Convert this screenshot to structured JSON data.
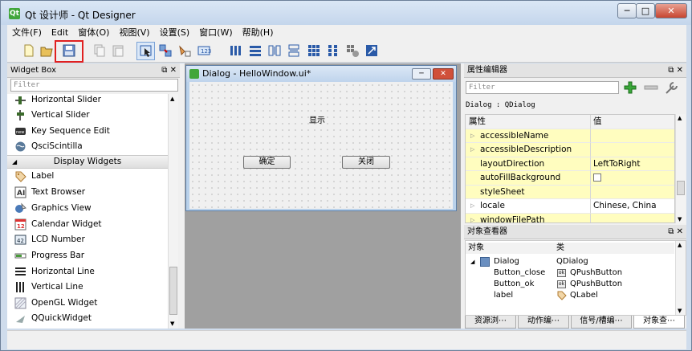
{
  "window": {
    "title": "Qt 设计师 - Qt Designer",
    "app_icon": "Qt"
  },
  "menu": [
    "文件(F)",
    "Edit",
    "窗体(O)",
    "视图(V)",
    "设置(S)",
    "窗口(W)",
    "帮助(H)"
  ],
  "toolbar_icons": [
    "new-file-icon",
    "open-file-icon",
    "save-icon",
    "copy-icon",
    "paste-icon",
    "edit-widgets-icon",
    "edit-signals-icon",
    "edit-buddies-icon",
    "edit-tab-order-icon",
    "layout-horizontal-icon",
    "layout-vertical-icon",
    "layout-h-splitter-icon",
    "layout-v-splitter-icon",
    "layout-grid-icon",
    "layout-form-icon",
    "break-layout-icon",
    "adjust-size-icon"
  ],
  "widget_box": {
    "title": "Widget Box",
    "controls": "⧉ ✕",
    "filter_placeholder": "Filter",
    "items_top": [
      {
        "label": "Horizontal Slider",
        "icon": "horizontal-slider-icon"
      },
      {
        "label": "Vertical Slider",
        "icon": "vertical-slider-icon"
      },
      {
        "label": "Key Sequence Edit",
        "icon": "key-sequence-edit-icon"
      },
      {
        "label": "QsciScintilla",
        "icon": "qsciscintilla-icon"
      }
    ],
    "category": "Display Widgets",
    "items_display": [
      {
        "label": "Label",
        "icon": "label-icon"
      },
      {
        "label": "Text Browser",
        "icon": "text-browser-icon"
      },
      {
        "label": "Graphics View",
        "icon": "graphics-view-icon"
      },
      {
        "label": "Calendar Widget",
        "icon": "calendar-widget-icon",
        "glyph": "12"
      },
      {
        "label": "LCD Number",
        "icon": "lcd-number-icon",
        "glyph": "42"
      },
      {
        "label": "Progress Bar",
        "icon": "progress-bar-icon"
      },
      {
        "label": "Horizontal Line",
        "icon": "horizontal-line-icon"
      },
      {
        "label": "Vertical Line",
        "icon": "vertical-line-icon"
      },
      {
        "label": "OpenGL Widget",
        "icon": "opengl-widget-icon"
      },
      {
        "label": "QQuickWidget",
        "icon": "qquickwidget-icon"
      }
    ]
  },
  "dialog": {
    "title": "Dialog - HelloWindow.ui*",
    "label_text": "显示",
    "ok_button": "确定",
    "close_button": "关闭"
  },
  "property_editor": {
    "title": "属性编辑器",
    "controls": "⧉ ✕",
    "filter_placeholder": "Filter",
    "object_caption": "Dialog : QDialog",
    "col_property": "属性",
    "col_value": "值",
    "rows": [
      {
        "name": "accessibleName",
        "value": "",
        "expandable": true
      },
      {
        "name": "accessibleDescription",
        "value": "",
        "expandable": true
      },
      {
        "name": "layoutDirection",
        "value": "LeftToRight",
        "expandable": false
      },
      {
        "name": "autoFillBackground",
        "value": "",
        "checkbox": true,
        "checked": false,
        "expandable": false
      },
      {
        "name": "styleSheet",
        "value": "",
        "expandable": false
      },
      {
        "name": "locale",
        "value": "Chinese, China",
        "expandable": true
      },
      {
        "name": "windowFilePath",
        "value": "",
        "expandable": true
      }
    ]
  },
  "object_inspector": {
    "title": "对象查看器",
    "controls": "⧉ ✕",
    "col_object": "对象",
    "col_class": "类",
    "rows": [
      {
        "object": "Dialog",
        "class": "QDialog",
        "level": 0
      },
      {
        "object": "Button_close",
        "class": "QPushButton",
        "level": 1
      },
      {
        "object": "Button_ok",
        "class": "QPushButton",
        "level": 1
      },
      {
        "object": "label",
        "class": "QLabel",
        "level": 1
      }
    ]
  },
  "bottom_tabs": [
    "资源浏⋯",
    "动作编⋯",
    "信号/槽编⋯",
    "对象查⋯"
  ],
  "colors": {
    "highlight_box": "#e02020",
    "property_yellow": "#fffdbf"
  }
}
